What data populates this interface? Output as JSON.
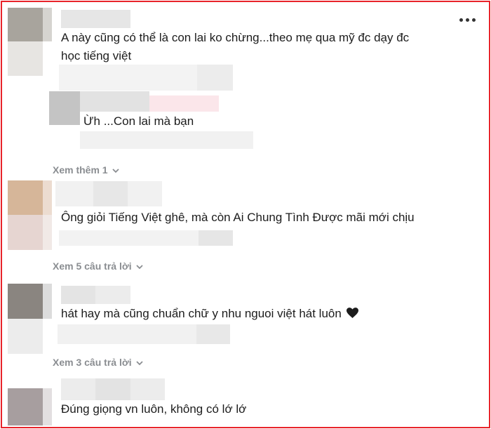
{
  "comments": [
    {
      "text_line1": "A này cũng có thể là con lai ko chừng...theo mẹ qua mỹ đc dạy đc",
      "text_line2": "học tiếng việt"
    },
    {
      "text": "Ừh ...Con lai mà bạn"
    },
    {
      "text": "Ông giỏi Tiếng Việt ghê, mà còn Ai Chung Tình Được mãi mới chịu"
    },
    {
      "text": "hát hay mà cũng chuẩn chữ y nhu nguoi việt hát luôn"
    },
    {
      "text": "Đúng giọng vn luôn, không có lớ lớ"
    }
  ],
  "show_more": [
    {
      "label": "Xem thêm 1"
    },
    {
      "label": "Xem 5 câu trả lời"
    },
    {
      "label": "Xem 3 câu trả lời"
    }
  ],
  "icons": {
    "heart": "black-heart-icon",
    "more": "more-options-icon",
    "chevron": "chevron-down-icon"
  },
  "colors": {
    "frame": "#e8232a",
    "muted": "#8a8d91"
  }
}
